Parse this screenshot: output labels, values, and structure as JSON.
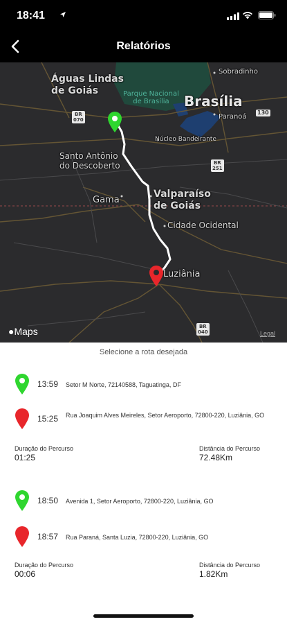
{
  "status": {
    "time": "18:41"
  },
  "nav": {
    "title": "Relatórios"
  },
  "map": {
    "labels": {
      "aguas_lindas": "Águas Lindas\nde Goiás",
      "sobradinho": "Sobradinho",
      "parque": "Parque Nacional\nde Brasília",
      "brasilia": "Brasília",
      "paranoa": "Paranoá",
      "nucleo": "Núcleo Bandeirante",
      "santo_antonio": "Santo Antônio\ndo Descoberto",
      "valparaiso": "Valparaíso\nde Goiás",
      "gama": "Gama",
      "cidade_ocidental": "Cidade Ocidental",
      "luziania": "Luziânia"
    },
    "shields": {
      "br070": "BR\n070",
      "br130": "130",
      "br251": "BR\n251",
      "br040": "BR\n040"
    },
    "logo": "Maps",
    "legal": "Legal"
  },
  "colors": {
    "start_pin": "#2fd62f",
    "end_pin": "#e8262b",
    "route": "#ffffff"
  },
  "prompt": "Selecione a rota desejada",
  "routes": [
    {
      "start_time": "13:59",
      "start_address": "Setor M Norte, 72140588, Taguatinga, DF",
      "end_time": "15:25",
      "end_address": "Rua Joaquim Alves Meireles, Setor Aeroporto, 72800-220, Luziânia, GO",
      "duration_label": "Duração do Percurso",
      "duration": "01:25",
      "distance_label": "Distância do Percurso",
      "distance": "72.48Km"
    },
    {
      "start_time": "18:50",
      "start_address": "Avenida 1, Setor Aeroporto, 72800-220, Luziânia, GO",
      "end_time": "18:57",
      "end_address": "Rua Paraná, Santa Luzia, 72800-220, Luziânia, GO",
      "duration_label": "Duração do Percurso",
      "duration": "00:06",
      "distance_label": "Distância do Percurso",
      "distance": "1.82Km"
    }
  ]
}
